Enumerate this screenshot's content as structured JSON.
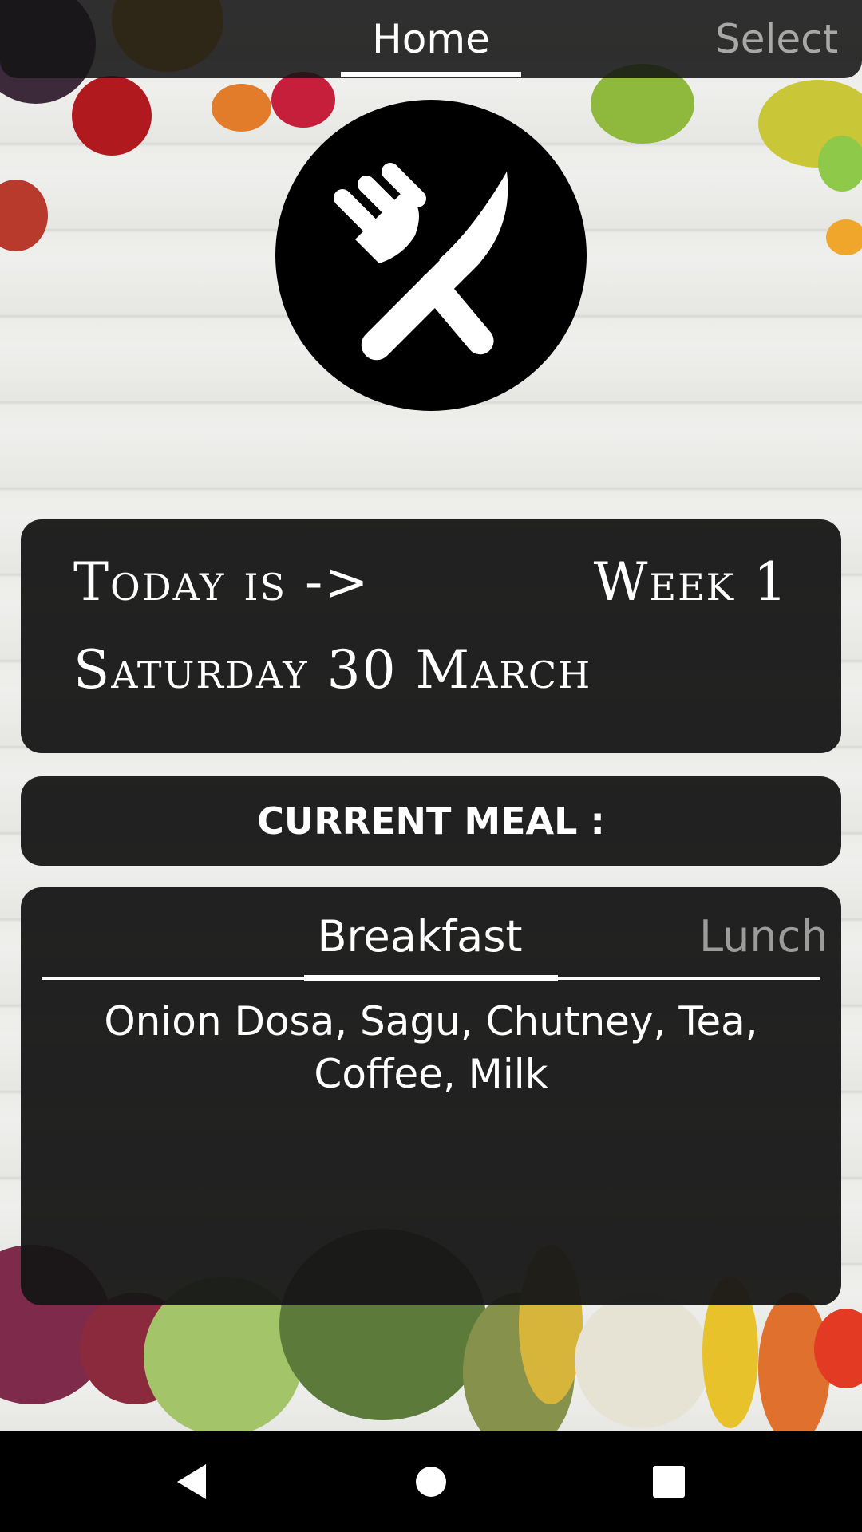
{
  "top_tabs": {
    "home_label": "Home",
    "select_label": "Select"
  },
  "logo": {
    "icon": "fork-knife-icon"
  },
  "date_card": {
    "today_label": "Today is ->",
    "week_label": "Week 1",
    "date_label": "Saturday 30 March"
  },
  "meal_header": {
    "label": "CURRENT MEAL :"
  },
  "meal_tabs": {
    "breakfast_label": "Breakfast",
    "lunch_label": "Lunch",
    "content": "Onion Dosa, Sagu, Chutney, Tea, Coffee, Milk"
  },
  "nav": {
    "back_icon": "back-triangle-icon",
    "home_icon": "home-circle-icon",
    "recent_icon": "recent-square-icon"
  }
}
